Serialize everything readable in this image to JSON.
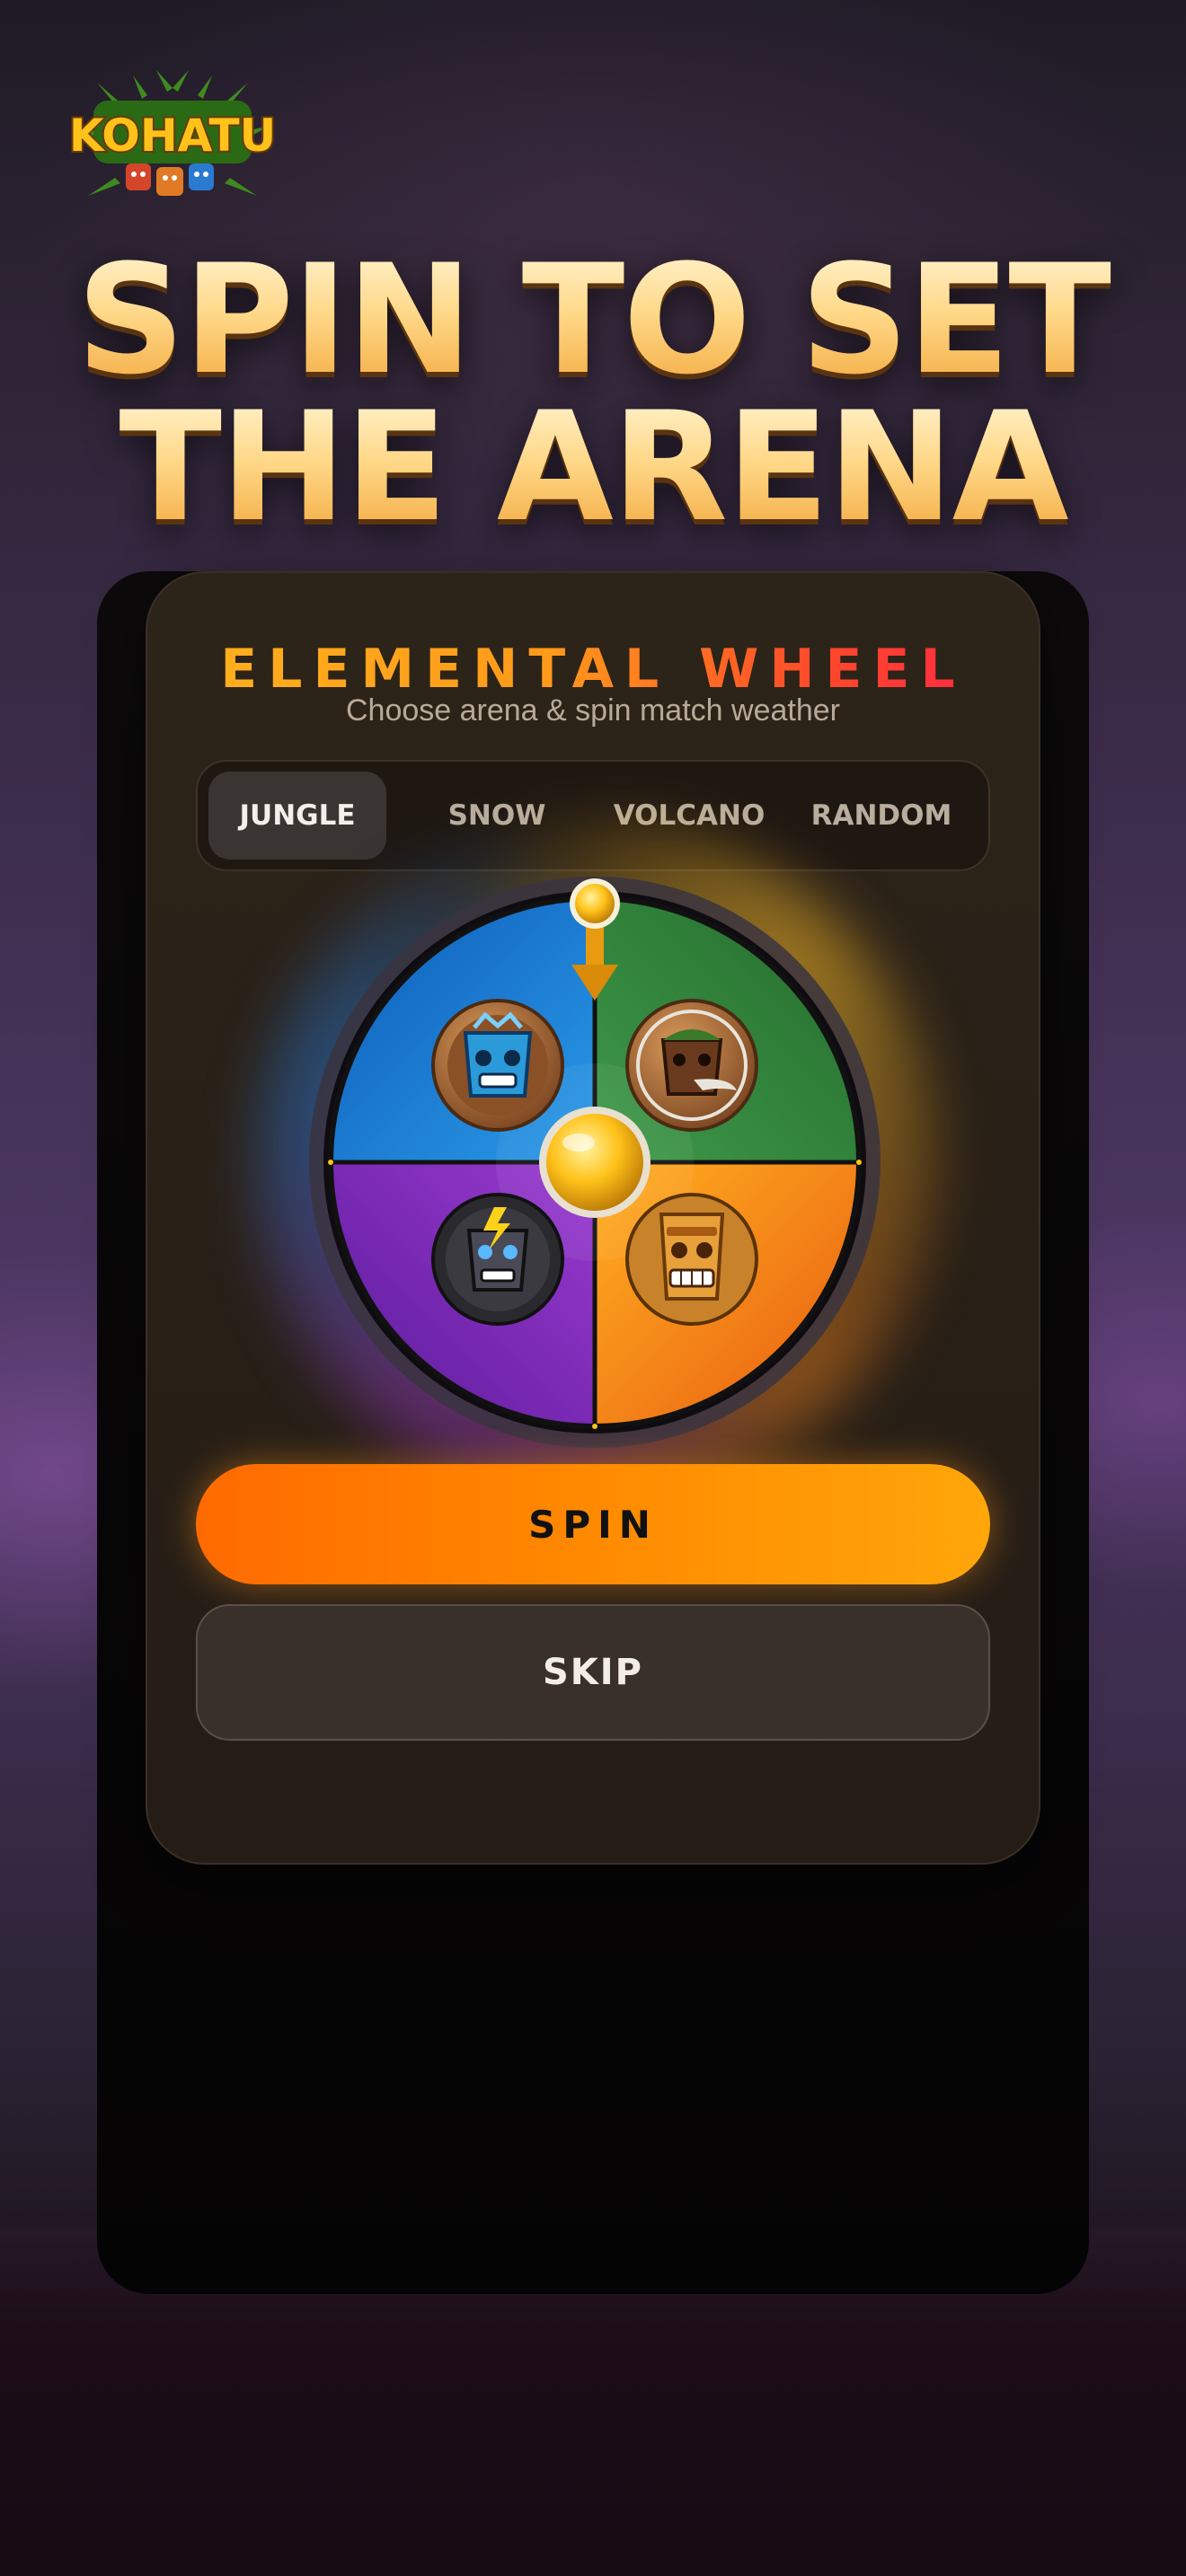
{
  "brand": {
    "logo_text": "KOHATU"
  },
  "headline": {
    "line1": "SPIN TO SET",
    "line2": "THE ARENA"
  },
  "panel": {
    "title": "ELEMENTAL WHEEL",
    "subtitle": "Choose arena & spin match weather",
    "tabs": [
      {
        "label": "JUNGLE",
        "active": true
      },
      {
        "label": "SNOW",
        "active": false
      },
      {
        "label": "VOLCANO",
        "active": false
      },
      {
        "label": "RANDOM",
        "active": false
      }
    ]
  },
  "wheel": {
    "segments": [
      {
        "name": "water",
        "color": "#1a6fd0",
        "icon": "blue-tiki-mask-icon"
      },
      {
        "name": "wind",
        "color": "#2e7d3a",
        "icon": "wind-tiki-mask-icon"
      },
      {
        "name": "storm",
        "color": "#7a2bb8",
        "icon": "lightning-tiki-mask-icon"
      },
      {
        "name": "fire",
        "color": "#ff8a12",
        "icon": "golden-tiki-mask-icon"
      }
    ],
    "pointer_icon": "pointer-arrow-icon",
    "hub_icon": "gold-hub-icon"
  },
  "actions": {
    "spin_label": "SPIN",
    "skip_label": "SKIP"
  }
}
